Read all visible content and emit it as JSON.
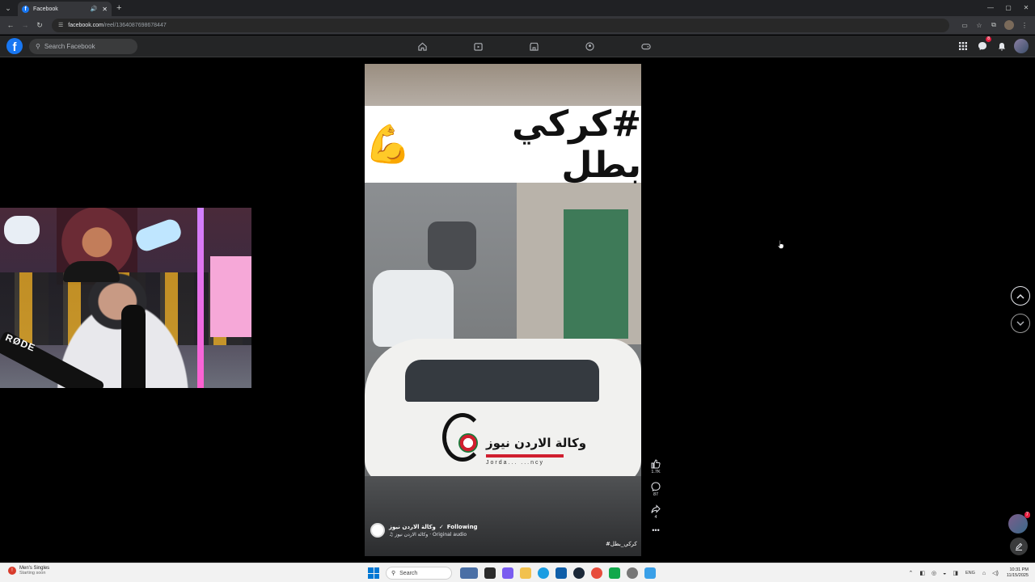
{
  "browser": {
    "tab_title": "Facebook",
    "url_host": "facebook.com",
    "url_path": "/reel/1364087698678447"
  },
  "facebook": {
    "logo_glyph": "f",
    "search_placeholder": "Search Facebook",
    "notifications_badge": "8",
    "nav_icons": [
      "home-icon",
      "video-icon",
      "marketplace-icon",
      "groups-icon",
      "gaming-icon"
    ]
  },
  "reel": {
    "banner_text": "#كركي بطل",
    "banner_emoji": "💪",
    "watermark_text": "وكالة الاردن نيوز",
    "watermark_sub": "Jorda... ...ncy",
    "author_name": "وكالة الاردن نيوز",
    "follow_status": "Following",
    "audio_text": "وكالة الاردن نيوز · Original audio",
    "caption": "#كركي_بطل",
    "likes": "1.7K",
    "comments": "87",
    "shares": "4"
  },
  "chat": {
    "unread_badge": "7"
  },
  "taskbar": {
    "weather_title": "Men's Singles",
    "weather_sub": "Starting soon",
    "search_placeholder": "Search",
    "language": "ENG",
    "time": "10:31 PM",
    "date": "11/15/2025"
  },
  "colors": {
    "fb_blue": "#1877f2",
    "fb_bar": "#242526",
    "badge_red": "#e41e3f"
  }
}
